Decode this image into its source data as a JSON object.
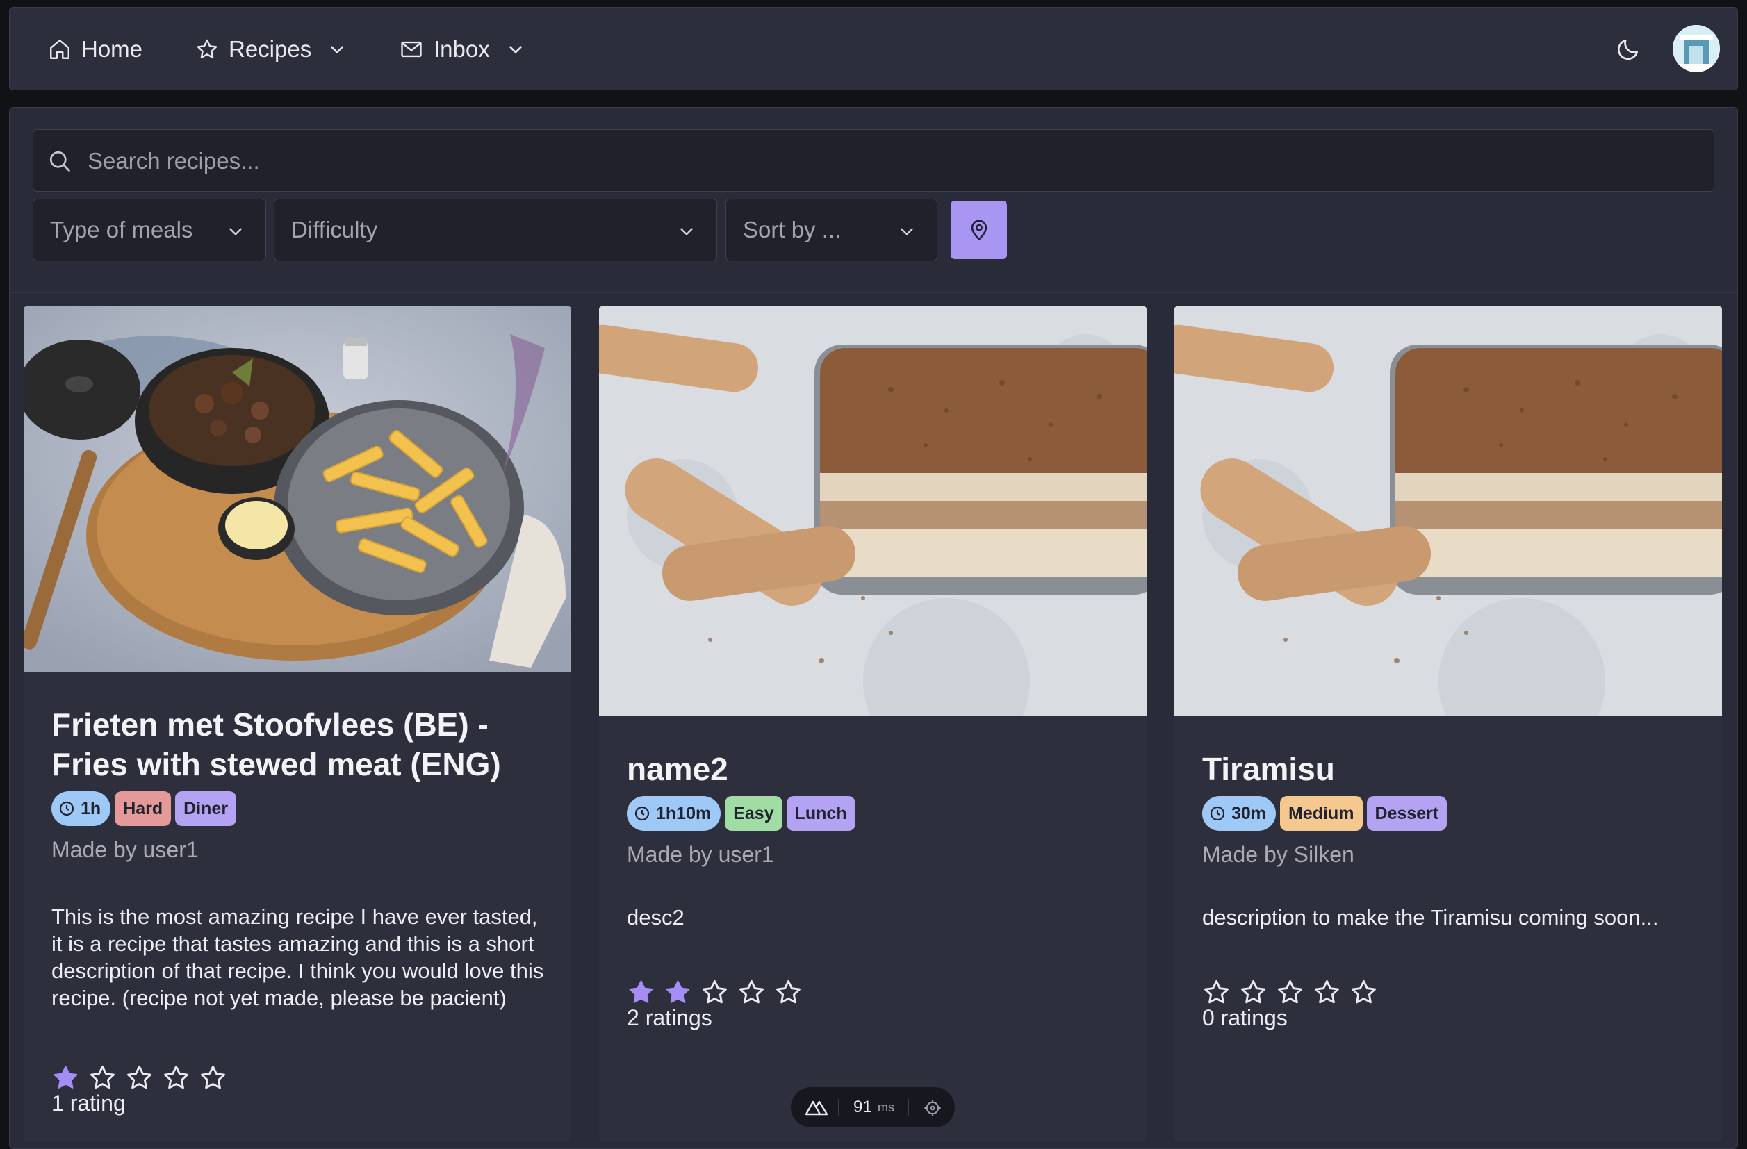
{
  "nav": {
    "home": "Home",
    "recipes": "Recipes",
    "inbox": "Inbox"
  },
  "filters": {
    "search_placeholder": "Search recipes...",
    "meal_type": "Type of meals",
    "difficulty": "Difficulty",
    "sort": "Sort by ..."
  },
  "colors": {
    "accent": "#a996f3",
    "panel": "#2a2b38",
    "card": "#2e2f3d",
    "star_filled": "#a48ef5"
  },
  "recipes": [
    {
      "title": "Frieten met Stoofvlees (BE) - Fries with stewed meat (ENG)",
      "time": "1h",
      "difficulty": "Hard",
      "category": "Diner",
      "author": "Made by user1",
      "description": "This is the most amazing recipe I have ever tasted, it is a recipe that tastes amazing and this is a short description of that recipe. I think you would love this recipe. (recipe not yet made, please be pacient)",
      "rating": 1,
      "rating_count": "1 rating"
    },
    {
      "title": "name2",
      "time": "1h10m",
      "difficulty": "Easy",
      "category": "Lunch",
      "author": "Made by user1",
      "description": "desc2",
      "rating": 2,
      "rating_count": "2 ratings"
    },
    {
      "title": "Tiramisu",
      "time": "30m",
      "difficulty": "Medium",
      "category": "Dessert",
      "author": "Made by Silken",
      "description": "description to make the Tiramisu coming soon...",
      "rating": 0,
      "rating_count": "0 ratings"
    }
  ],
  "devtools": {
    "value": "91",
    "unit": "ms"
  }
}
